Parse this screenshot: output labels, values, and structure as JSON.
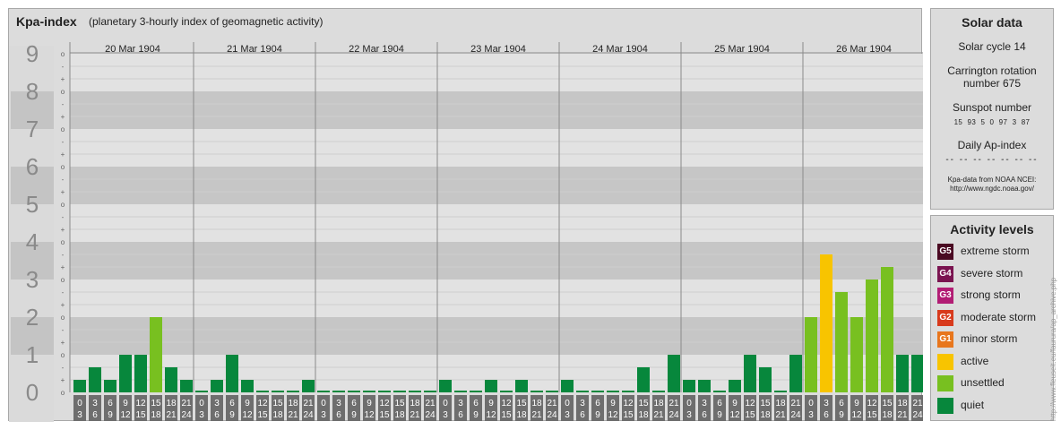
{
  "header": {
    "title": "Kpa-index",
    "subtitle": "(planetary 3-hourly index of geomagnetic activity)"
  },
  "chart_data": {
    "type": "bar",
    "title": "Kpa-index",
    "subtitle": "(planetary 3-hourly index of geomagnetic activity)",
    "ylim": [
      0,
      9
    ],
    "y_ticks": [
      "0",
      "1",
      "2",
      "3",
      "4",
      "5",
      "6",
      "7",
      "8",
      "9"
    ],
    "sub_ticks": [
      "-",
      "o",
      "+"
    ],
    "days": [
      "20 Mar 1904",
      "21 Mar 1904",
      "22 Mar 1904",
      "23 Mar 1904",
      "24 Mar 1904",
      "25 Mar 1904",
      "26 Mar 1904"
    ],
    "interval_start": [
      "0",
      "3",
      "6",
      "9",
      "12",
      "15",
      "18",
      "21"
    ],
    "interval_end": [
      "3",
      "6",
      "9",
      "12",
      "15",
      "18",
      "21",
      "24"
    ],
    "values": [
      [
        0.333,
        0.667,
        0.333,
        1.0,
        1.0,
        2.0,
        0.667,
        0.333
      ],
      [
        0.0,
        0.333,
        1.0,
        0.333,
        0.0,
        0.0,
        0.0,
        0.333
      ],
      [
        0.0,
        0.0,
        0.0,
        0.0,
        0.0,
        0.0,
        0.0,
        0.0
      ],
      [
        0.333,
        0.0,
        0.0,
        0.333,
        0.0,
        0.333,
        0.0,
        0.0
      ],
      [
        0.333,
        0.0,
        0.0,
        0.0,
        0.0,
        0.667,
        0.0,
        1.0
      ],
      [
        0.333,
        0.333,
        0.0,
        0.333,
        1.0,
        0.667,
        0.0,
        1.0
      ],
      [
        2.0,
        3.667,
        2.667,
        2.0,
        3.0,
        3.333,
        1.0,
        1.0
      ]
    ],
    "levels": [
      {
        "name": "quiet",
        "min": 0,
        "color": "#07873c"
      },
      {
        "name": "unsettled",
        "min": 1.666,
        "color": "#78c020"
      },
      {
        "name": "active",
        "min": 3.5,
        "color": "#f8c400"
      }
    ],
    "grid": true
  },
  "solar": {
    "title": "Solar data",
    "cycle": "Solar cycle 14",
    "carrington_line1": "Carrington rotation",
    "carrington_line2": "number 675",
    "sunspot_label": "Sunspot number",
    "sunspot_values": "15  93  5  0  97  3  87",
    "ap_label": "Daily Ap-index",
    "ap_values": "-- -- -- -- -- -- --",
    "source_line1": "Kpa-data from NOAA NCEI:",
    "source_line2": "http://www.ngdc.noaa.gov/"
  },
  "levels_panel": {
    "title": "Activity levels",
    "items": [
      {
        "code": "G5",
        "label": "extreme storm",
        "color": "#4a0a22"
      },
      {
        "code": "G4",
        "label": "severe storm",
        "color": "#7a1450"
      },
      {
        "code": "G3",
        "label": "strong storm",
        "color": "#b21c74"
      },
      {
        "code": "G2",
        "label": "moderate storm",
        "color": "#d83a1c"
      },
      {
        "code": "G1",
        "label": "minor storm",
        "color": "#e8761c"
      },
      {
        "code": "",
        "label": "active",
        "color": "#f8c400"
      },
      {
        "code": "",
        "label": "unsettled",
        "color": "#78c020"
      },
      {
        "code": "",
        "label": "quiet",
        "color": "#07873c"
      }
    ]
  },
  "credit": "http://www.fleuseit.eu/faurura/ap_archive.php"
}
